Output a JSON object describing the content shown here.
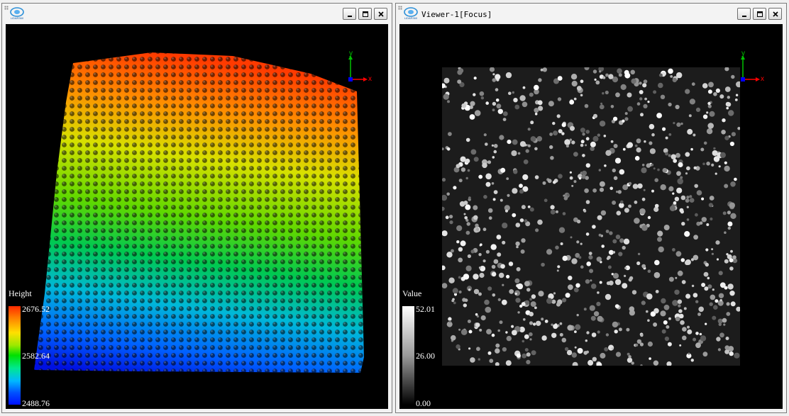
{
  "left_viewer": {
    "title": "",
    "legend": {
      "title": "Height",
      "max": "2676.52",
      "mid": "2582.64",
      "min": "2488.76"
    },
    "axes": {
      "y_label": "y",
      "x_label": "x"
    }
  },
  "right_viewer": {
    "title": "Viewer-1[Focus]",
    "legend": {
      "title": "Value",
      "max": "52.01",
      "mid": "26.00",
      "min": "0.00"
    },
    "axes": {
      "y_label": "y",
      "x_label": "x"
    }
  },
  "icons": {
    "logo": "lidar360-logo-icon",
    "minimize": "minimize-icon",
    "maximize": "maximize-icon",
    "close": "close-icon"
  },
  "colors": {
    "canvas_background": "#000000",
    "axis_x": "#ff0000",
    "axis_y": "#00c000",
    "axis_z": "#0000ff"
  }
}
